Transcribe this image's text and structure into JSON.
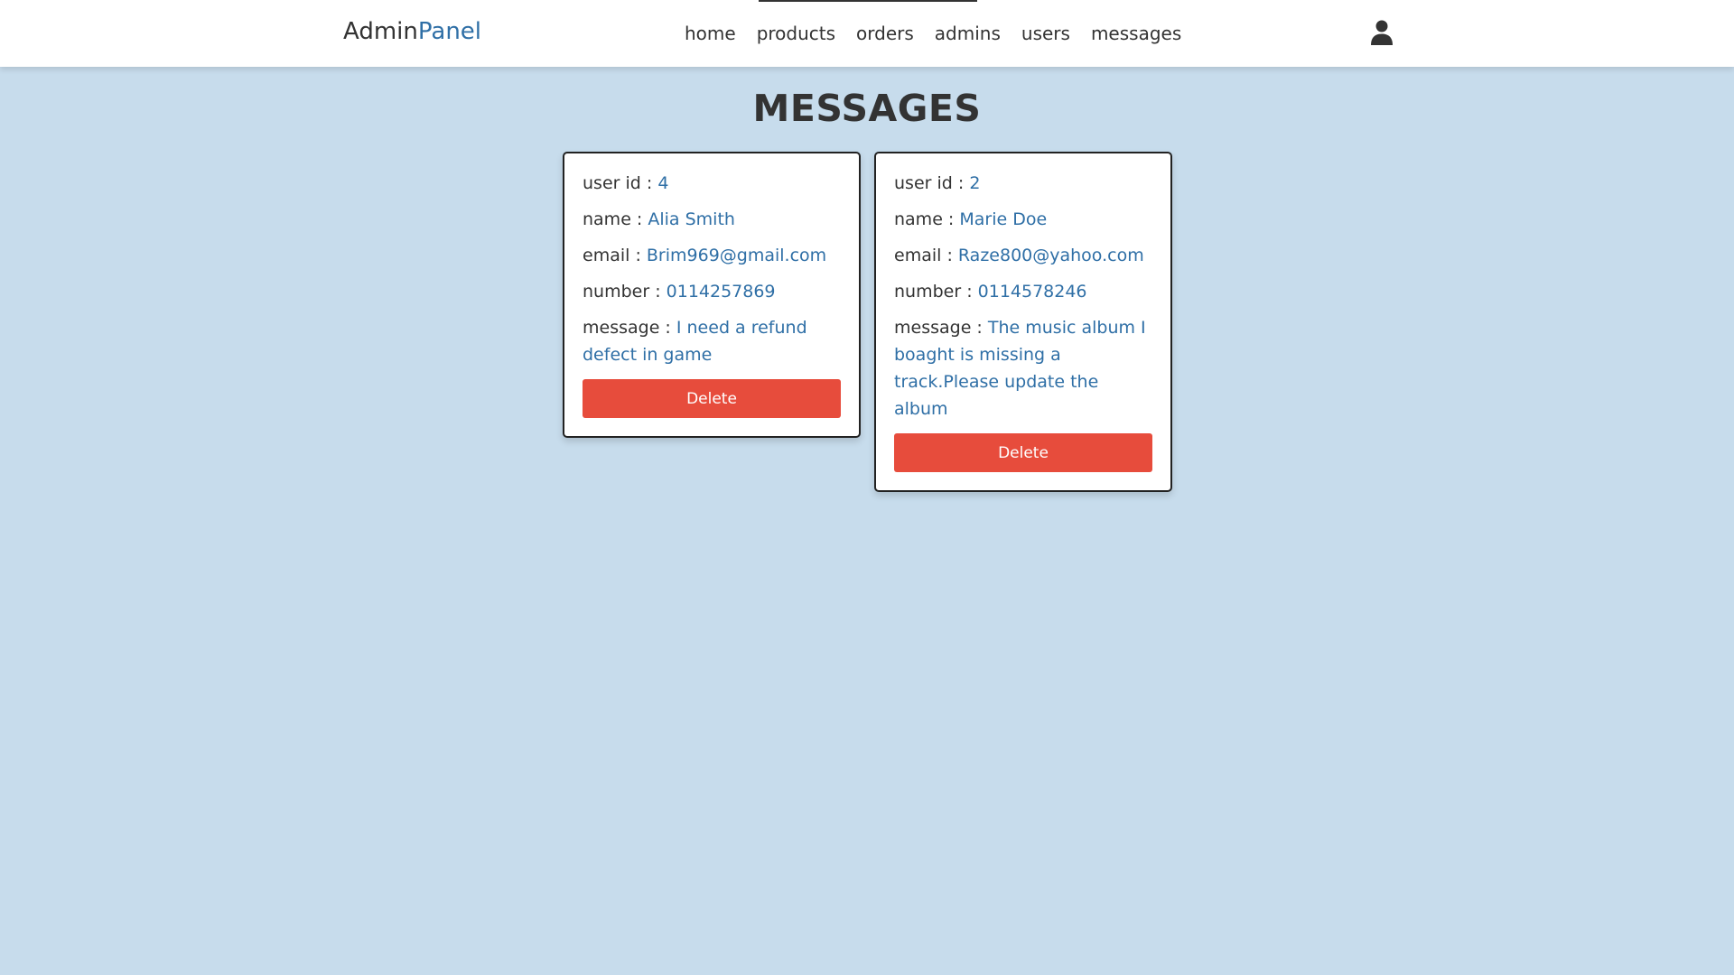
{
  "header": {
    "logo_part1": "Admin",
    "logo_part2": "Panel",
    "nav": [
      "home",
      "products",
      "orders",
      "admins",
      "users",
      "messages"
    ],
    "user_icon": "user-icon"
  },
  "page": {
    "title": "MESSAGES"
  },
  "messages": [
    {
      "user_id_label": "user id : ",
      "user_id": "4",
      "name_label": "name : ",
      "name": "Alia Smith",
      "email_label": "email : ",
      "email": "Brim969@gmail.com",
      "number_label": "number : ",
      "number": "0114257869",
      "message_label": "message : ",
      "message": "I need a refund defect in game",
      "delete_label": "Delete"
    },
    {
      "user_id_label": "user id : ",
      "user_id": "2",
      "name_label": "name : ",
      "name": "Marie Doe",
      "email_label": "email : ",
      "email": "Raze800@yahoo.com",
      "number_label": "number : ",
      "number": "0114578246",
      "message_label": "message : ",
      "message": "The music album I boaght is missing a track.Please update the album",
      "delete_label": "Delete"
    }
  ],
  "colors": {
    "background": "#c7dcec",
    "accent": "#2f6fa6",
    "delete": "#e74c3c",
    "text": "#333333"
  }
}
